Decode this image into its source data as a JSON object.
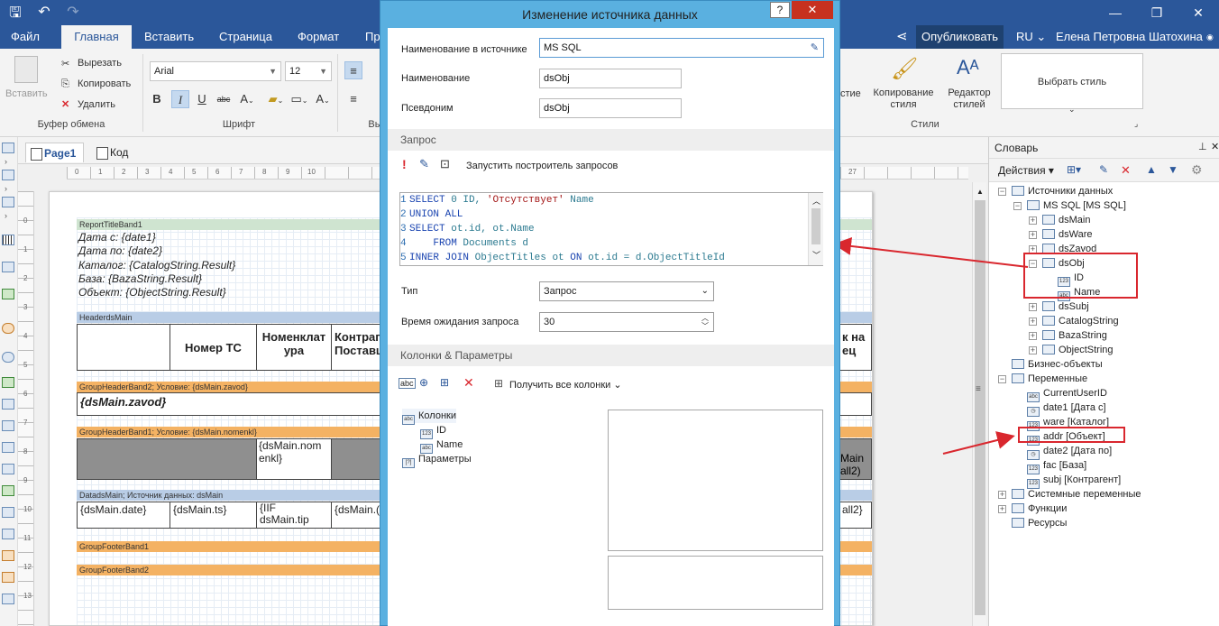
{
  "window": {
    "minimize_glyph": "—",
    "restore_glyph": "❐",
    "close_glyph": "✕"
  },
  "tabs": {
    "file": "Файл",
    "home": "Главная",
    "insert": "Вставить",
    "page": "Страница",
    "format": "Формат",
    "partial": "Пр",
    "publish": "Опубликовать",
    "lang": "RU",
    "user": "Елена Петровна Шатохина"
  },
  "ribbon": {
    "paste": "Вставить",
    "cut": "Вырезать",
    "copy": "Копировать",
    "delete": "Удалить",
    "clipboard_group": "Буфер обмена",
    "font_name": "Arial",
    "font_size": "12",
    "font_group": "Шрифт",
    "bold": "B",
    "italic": "I",
    "underline": "U",
    "strike": "abc",
    "align_group_partial": "Вы",
    "styles_partial": "стие",
    "copy_style": "Копирование стиля",
    "style_editor": "Редактор стилей",
    "choose_style": "Выбрать стиль",
    "styles_group": "Стили"
  },
  "designer": {
    "tab_page": "Page1",
    "tab_code": "Код"
  },
  "ruler": {
    "h": [
      "0",
      "1",
      "2",
      "3",
      "4",
      "5",
      "6",
      "7",
      "8",
      "9",
      "10",
      "27"
    ],
    "v": [
      "0",
      "1",
      "2",
      "3",
      "4",
      "5",
      "6",
      "7",
      "8",
      "9",
      "10",
      "11",
      "12",
      "13"
    ]
  },
  "report": {
    "title_band": "ReportTitleBand1",
    "title_lines": [
      "Дата  с: {date1}",
      "Дата по: {date2}",
      "Каталог: {CatalogString.Result}",
      "База: {BazaString.Result}",
      "Объект: {ObjectString.Result}"
    ],
    "headers_band": "HeaderdsMain",
    "header_cells": [
      "Номер ТС",
      "Номенклат ура",
      "Контраг Поставщ",
      "к на ец"
    ],
    "group2_band": "GroupHeaderBand2; Условие: {dsMain.zavod}",
    "group2_cell": "{dsMain.zavod}",
    "group1_band": "GroupHeaderBand1; Условие: {dsMain.nomenkl}",
    "group1_cells": [
      "{dsMain.nom enkl}",
      "Main all2)"
    ],
    "data_band": "DatadsMain; Источник данных: dsMain",
    "data_cells": [
      "{dsMain.date}",
      "{dsMain.ts}",
      "{IIF dsMain.tip",
      "{dsMain.(",
      "all2}"
    ],
    "footer1": "GroupFooterBand1",
    "footer2": "GroupFooterBand2"
  },
  "dictionary": {
    "title": "Словарь",
    "actions": "Действия",
    "tree": [
      {
        "label": "Источники данных",
        "level": 0,
        "exp": "−"
      },
      {
        "label": "MS SQL [MS SQL]",
        "level": 1,
        "exp": "−"
      },
      {
        "label": "dsMain",
        "level": 2,
        "exp": "+"
      },
      {
        "label": "dsWare",
        "level": 2,
        "exp": "+"
      },
      {
        "label": "dsZavod",
        "level": 2,
        "exp": "+"
      },
      {
        "label": "dsObj",
        "level": 2,
        "exp": "−"
      },
      {
        "label": "ID",
        "level": 3,
        "exp": "",
        "badge": "123"
      },
      {
        "label": "Name",
        "level": 3,
        "exp": "",
        "badge": "abc"
      },
      {
        "label": "dsSubj",
        "level": 2,
        "exp": "+"
      },
      {
        "label": "CatalogString",
        "level": 2,
        "exp": "+"
      },
      {
        "label": "BazaString",
        "level": 2,
        "exp": "+"
      },
      {
        "label": "ObjectString",
        "level": 2,
        "exp": "+"
      },
      {
        "label": "Бизнес-объекты",
        "level": 0,
        "exp": ""
      },
      {
        "label": "Переменные",
        "level": 0,
        "exp": "−"
      },
      {
        "label": "CurrentUserID",
        "level": 1,
        "exp": "",
        "badge": "abc"
      },
      {
        "label": "date1 [Дата с]",
        "level": 1,
        "exp": "",
        "badge": "◷"
      },
      {
        "label": "ware [Каталог]",
        "level": 1,
        "exp": "",
        "badge": "123"
      },
      {
        "label": "addr [Объект]",
        "level": 1,
        "exp": "",
        "badge": "123"
      },
      {
        "label": "date2 [Дата по]",
        "level": 1,
        "exp": "",
        "badge": "◷"
      },
      {
        "label": "fac [База]",
        "level": 1,
        "exp": "",
        "badge": "123"
      },
      {
        "label": "subj [Контрагент]",
        "level": 1,
        "exp": "",
        "badge": "123"
      },
      {
        "label": "Системные переменные",
        "level": 0,
        "exp": "+"
      },
      {
        "label": "Функции",
        "level": 0,
        "exp": "+"
      },
      {
        "label": "Ресурсы",
        "level": 0,
        "exp": ""
      }
    ]
  },
  "dialog": {
    "title": "Изменение источника данных",
    "help": "?",
    "close": "✕",
    "source_name_label": "Наименование в источнике",
    "source_name_value": "MS SQL",
    "name_label": "Наименование",
    "name_value": "dsObj",
    "alias_label": "Псевдоним",
    "alias_value": "dsObj",
    "query_section": "Запрос",
    "run_builder": "Запустить построитель запросов",
    "type_label": "Тип",
    "type_value": "Запрос",
    "timeout_label": "Время ожидания запроса",
    "timeout_value": "30",
    "columns_section": "Колонки & Параметры",
    "get_all_columns": "Получить все колонки",
    "tree": [
      {
        "label": "Колонки",
        "level": 0,
        "badge": "abc"
      },
      {
        "label": "ID",
        "level": 1,
        "badge": "123"
      },
      {
        "label": "Name",
        "level": 1,
        "badge": "abc"
      },
      {
        "label": "Параметры",
        "level": 0,
        "badge": "[?]"
      }
    ]
  },
  "colors": {
    "title_bar": "#2b579a",
    "dialog_frame": "#5ab0e0",
    "close_red": "#c7311f",
    "annotation_red": "#d9272e"
  }
}
